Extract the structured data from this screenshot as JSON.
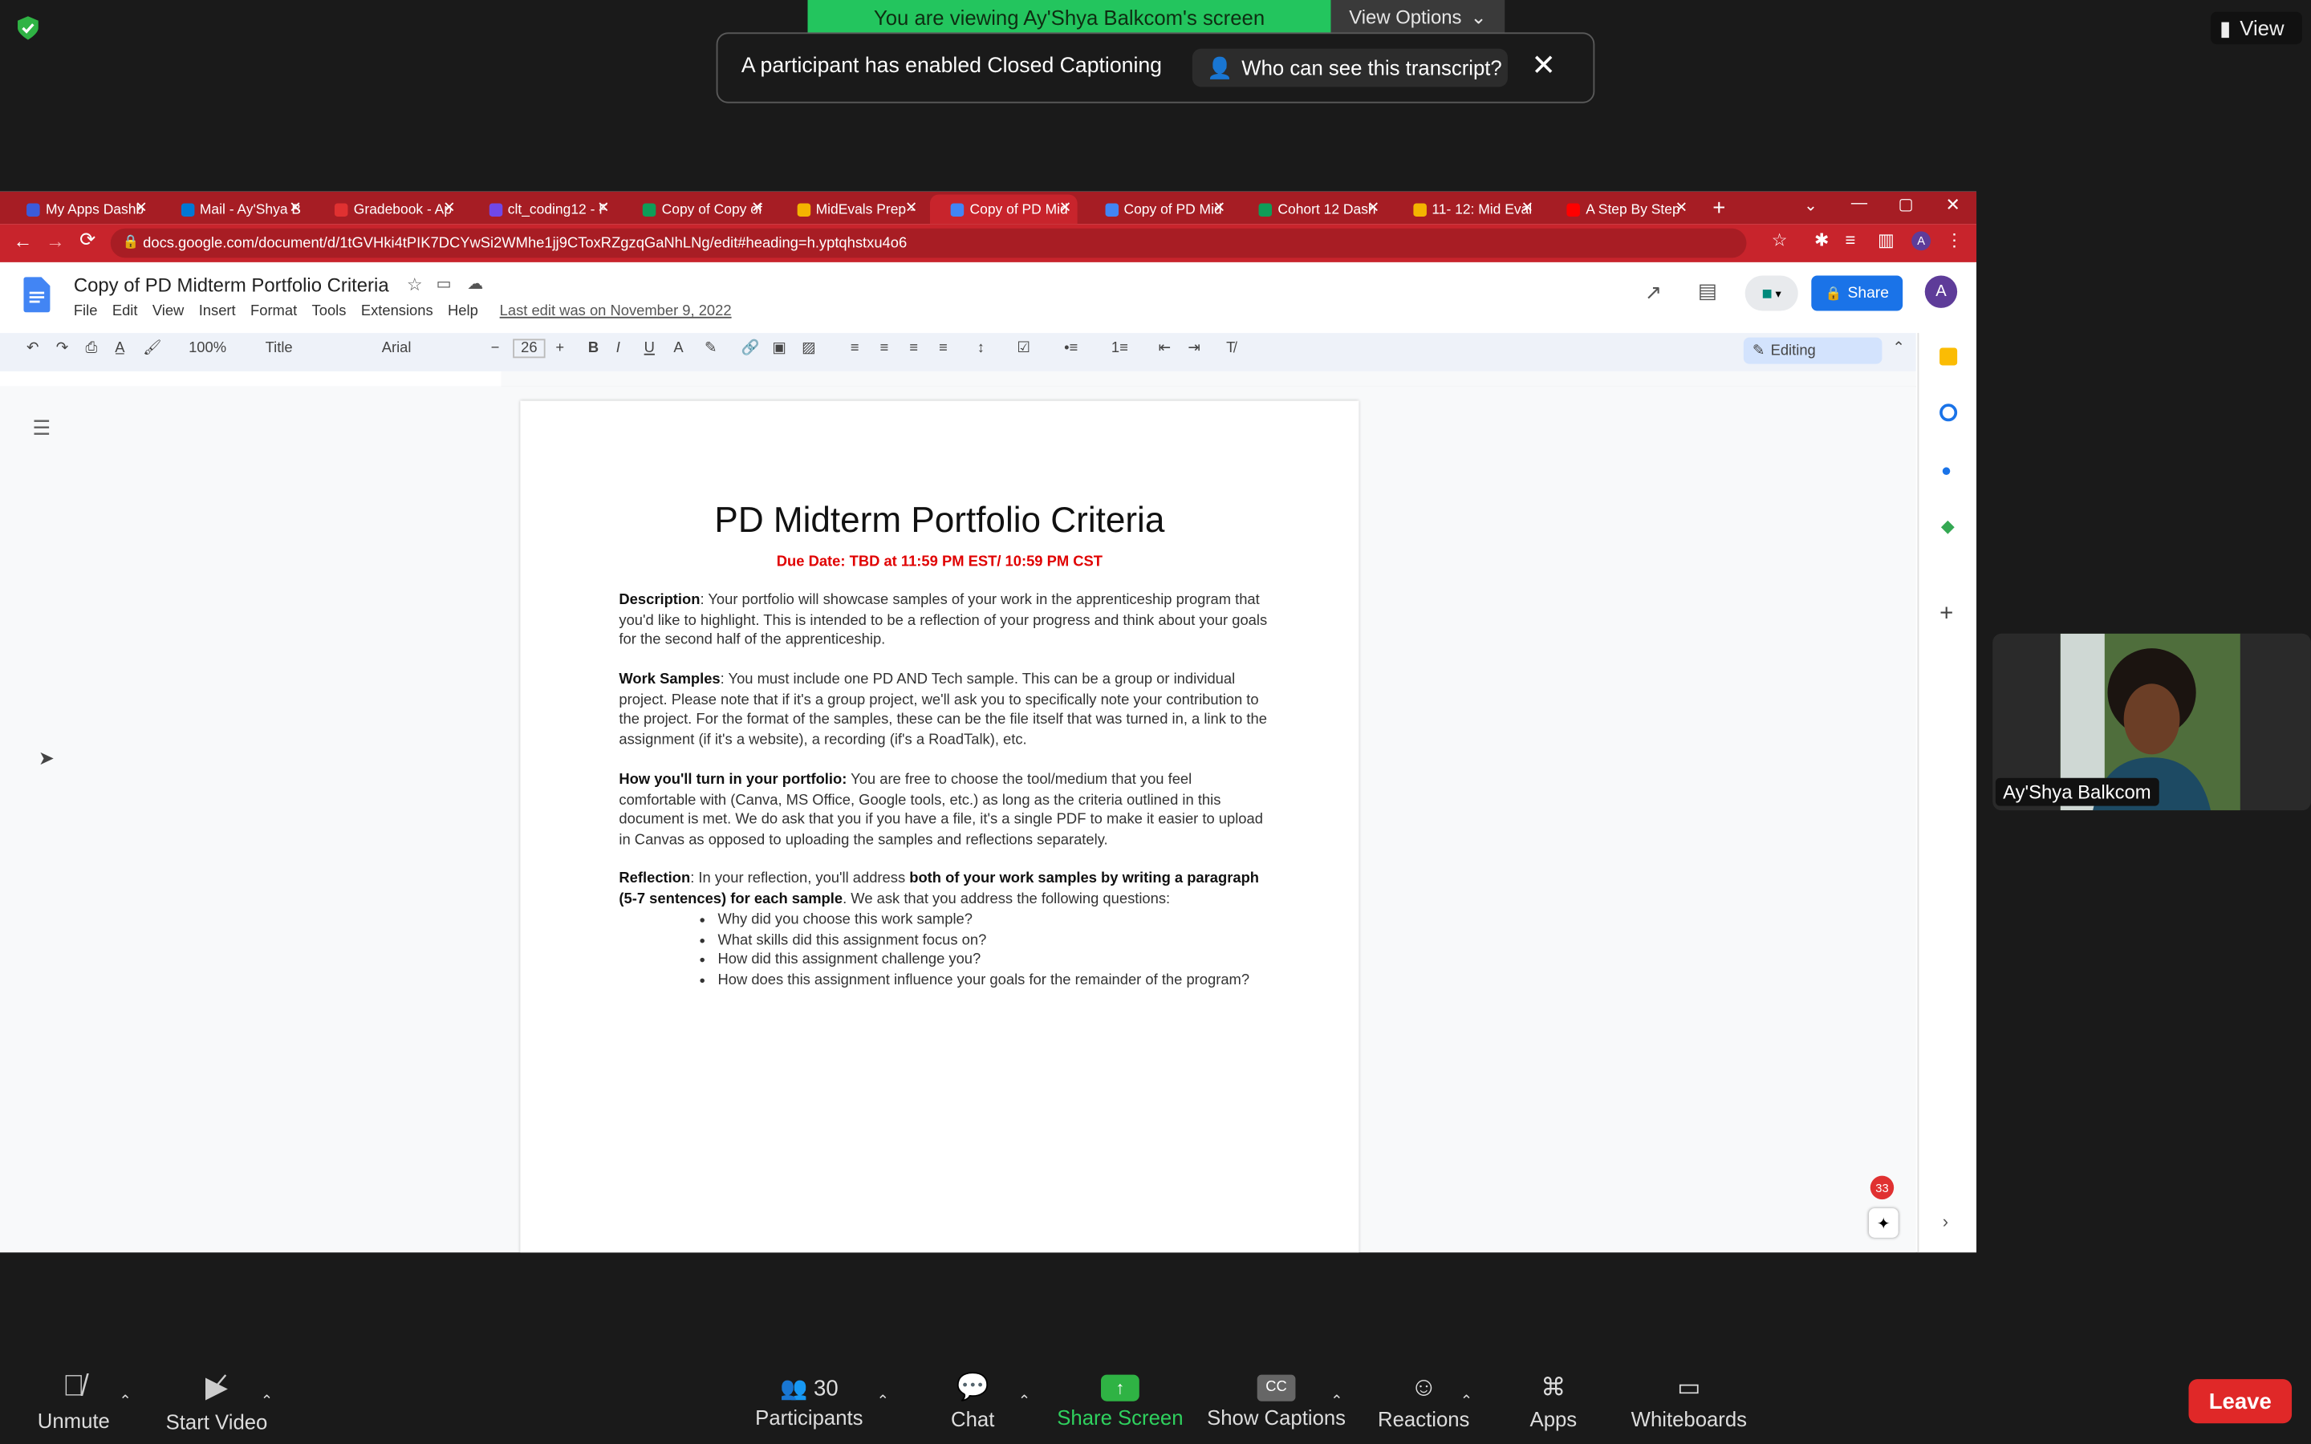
{
  "zoom": {
    "banner": "You are viewing Ay'Shya Balkcom's screen",
    "view_options": "View Options",
    "cc_notice": "A participant has enabled Closed Captioning",
    "cc_who": "Who can see this transcript?",
    "view": "View",
    "participant_name": "Ay'Shya Balkcom",
    "controls": {
      "unmute": "Unmute",
      "start_video": "Start Video",
      "participants": "Participants",
      "participants_count": "30",
      "chat": "Chat",
      "share_screen": "Share Screen",
      "show_captions": "Show Captions",
      "reactions": "Reactions",
      "apps": "Apps",
      "whiteboards": "Whiteboards",
      "leave": "Leave"
    }
  },
  "browser": {
    "tabs": [
      {
        "label": "My Apps Dashb",
        "color": "#3b5bdb"
      },
      {
        "label": "Mail - Ay'Shya B",
        "color": "#0078d4"
      },
      {
        "label": "Gradebook - Ap",
        "color": "#e03131"
      },
      {
        "label": "clt_coding12 - F",
        "color": "#7048e8"
      },
      {
        "label": "Copy of Copy of",
        "color": "#0f9d58"
      },
      {
        "label": "MidEvals Prep -",
        "color": "#f4b400"
      },
      {
        "label": "Copy of PD Mid",
        "color": "#4285f4"
      },
      {
        "label": "Copy of PD Mid",
        "color": "#4285f4"
      },
      {
        "label": "Cohort 12 Dash",
        "color": "#0f9d58"
      },
      {
        "label": "11- 12: Mid Eval",
        "color": "#f4b400"
      },
      {
        "label": "A Step By Step",
        "color": "#ff0000"
      }
    ],
    "url": "docs.google.com/document/d/1tGVHki4tPIK7DCYwSi2WMhe1jj9CToxRZgzqGaNhLNg/edit#heading=h.yptqhstxu4o6"
  },
  "docs": {
    "title": "Copy of PD Midterm Portfolio Criteria",
    "menu": [
      "File",
      "Edit",
      "View",
      "Insert",
      "Format",
      "Tools",
      "Extensions",
      "Help"
    ],
    "last_edit": "Last edit was on November 9, 2022",
    "share": "Share",
    "avatar": "A",
    "zoom": "100%",
    "style": "Title",
    "font": "Arial",
    "font_size": "26",
    "mode": "Editing",
    "notification_count": "33",
    "page": {
      "heading": "PD Midterm Portfolio Criteria",
      "due": "Due Date: TBD at 11:59 PM EST/ 10:59 PM CST",
      "desc_label": "Description",
      "desc_text": ": Your portfolio will showcase samples of your work in the apprenticeship program that you'd like to highlight. This is intended to be a reflection of your progress and think about your goals for the second half of the apprenticeship.",
      "work_label": "Work Samples",
      "work_text": ": You must include one PD AND Tech sample. This can be a group or individual project. Please note that if it's a group project, we'll ask you to specifically note your contribution to the project. For the format of the samples, these can be the file itself that was turned in, a link to the assignment (if it's a website), a recording (if's a RoadTalk), etc.",
      "turnin_label": "How you'll turn in your portfolio:",
      "turnin_text": " You are free to choose the tool/medium that you feel comfortable with (Canva, MS Office, Google tools, etc.) as long as the criteria outlined in this document is met. We do ask that you if you have a file, it's a single PDF to make it easier to upload in Canvas as opposed to uploading the samples and reflections separately.",
      "refl_label": "Reflection",
      "refl_text1": ": In your reflection, you'll address ",
      "refl_bold": "both of your work samples by writing a paragraph (5-7 sentences) for each sample",
      "refl_text2": ". We ask that you address the following questions:",
      "questions": [
        "Why did you choose this work sample?",
        "What skills did this assignment focus on?",
        "How did this assignment challenge you?",
        "How does this assignment influence your goals for the remainder of the program?"
      ]
    }
  }
}
